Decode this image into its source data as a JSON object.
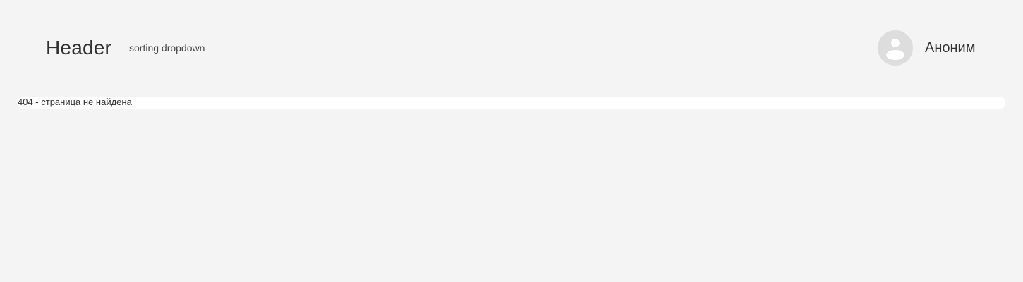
{
  "header": {
    "title": "Header",
    "sorting_dropdown_label": "sorting dropdown"
  },
  "user": {
    "name": "Аноним",
    "avatar_icon": "user-avatar-icon"
  },
  "content": {
    "message": "404 - страница не найдена"
  },
  "colors": {
    "background": "#f4f4f4",
    "panel": "#ffffff",
    "avatar_bg": "#dddddd",
    "avatar_fg": "#ffffff",
    "text": "#333333"
  }
}
